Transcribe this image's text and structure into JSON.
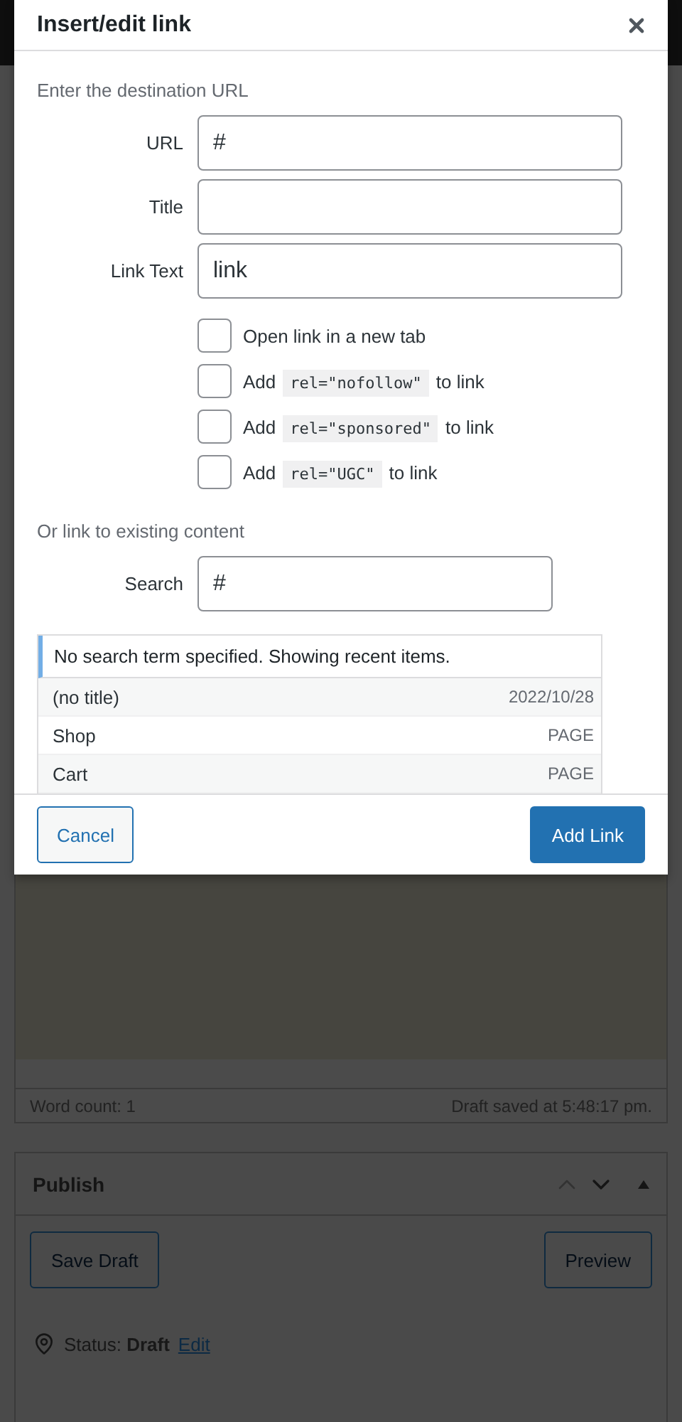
{
  "page": {
    "word_count": "Word count: 1",
    "save_status": "Draft saved at 5:48:17 pm.",
    "publish": {
      "title": "Publish",
      "buttons": [
        "Save Draft",
        "Preview"
      ],
      "status": "Status: **Draft**",
      "status_link": "Edit"
    }
  },
  "dialog": {
    "title": "Insert/edit link",
    "intro": "Enter the destination URL",
    "fields": [
      {
        "label": "URL",
        "value": "#"
      },
      {
        "label": "Title"
      },
      {
        "label": "Link Text",
        "value": "link"
      }
    ],
    "options": [
      {
        "kind": "plain",
        "label": "Open link in a new tab",
        "checked": false
      },
      {
        "kind": "code",
        "prefix": "Add",
        "code": "rel=\"nofollow\"",
        "suffix": "to link",
        "checked": false
      },
      {
        "kind": "code",
        "prefix": "Add",
        "code": "rel=\"sponsored\"",
        "suffix": "to link",
        "checked": false
      },
      {
        "kind": "code",
        "prefix": "Add",
        "code": "rel=\"UGC\"",
        "suffix": "to link",
        "checked": false
      }
    ],
    "existing_heading": "Or link to existing content",
    "search": {
      "label": "Search",
      "value": "#"
    },
    "notice": "No search term specified. Showing recent items.",
    "results": [
      {
        "title": "(no title)",
        "info": "2022/10/28"
      },
      {
        "title": "Shop",
        "info": "PAGE"
      },
      {
        "title": "Cart",
        "info": "PAGE"
      }
    ],
    "buttons": {
      "cancel": "Cancel",
      "submit": "Add Link"
    }
  }
}
